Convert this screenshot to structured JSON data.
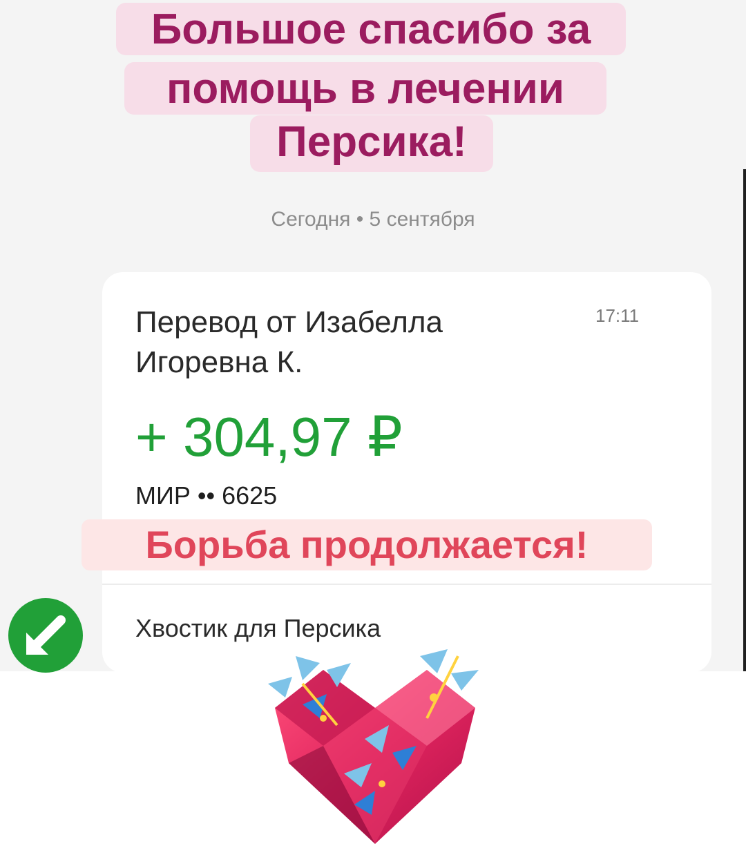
{
  "banner": {
    "line1": "Большое спасибо за",
    "line2": "помощь в лечении",
    "line3": "Персика!"
  },
  "date_header": "Сегодня • 5 сентября",
  "transfer": {
    "title": "Перевод от Изабелла Игоревна К.",
    "time": "17:11",
    "amount": "+ 304,97 ₽",
    "card": "МИР •• 6625",
    "comment": "Хвостик для Персика",
    "icon": "incoming-arrow-icon"
  },
  "overlay_text": "Борьба продолжается!",
  "sticker": "heart-with-flowers-illustration",
  "colors": {
    "banner_text": "#9b1c5f",
    "banner_bg": "#f7dde8",
    "amount_green": "#21a038",
    "fight_text": "#e0465a",
    "fight_bg": "#fde6e6"
  }
}
